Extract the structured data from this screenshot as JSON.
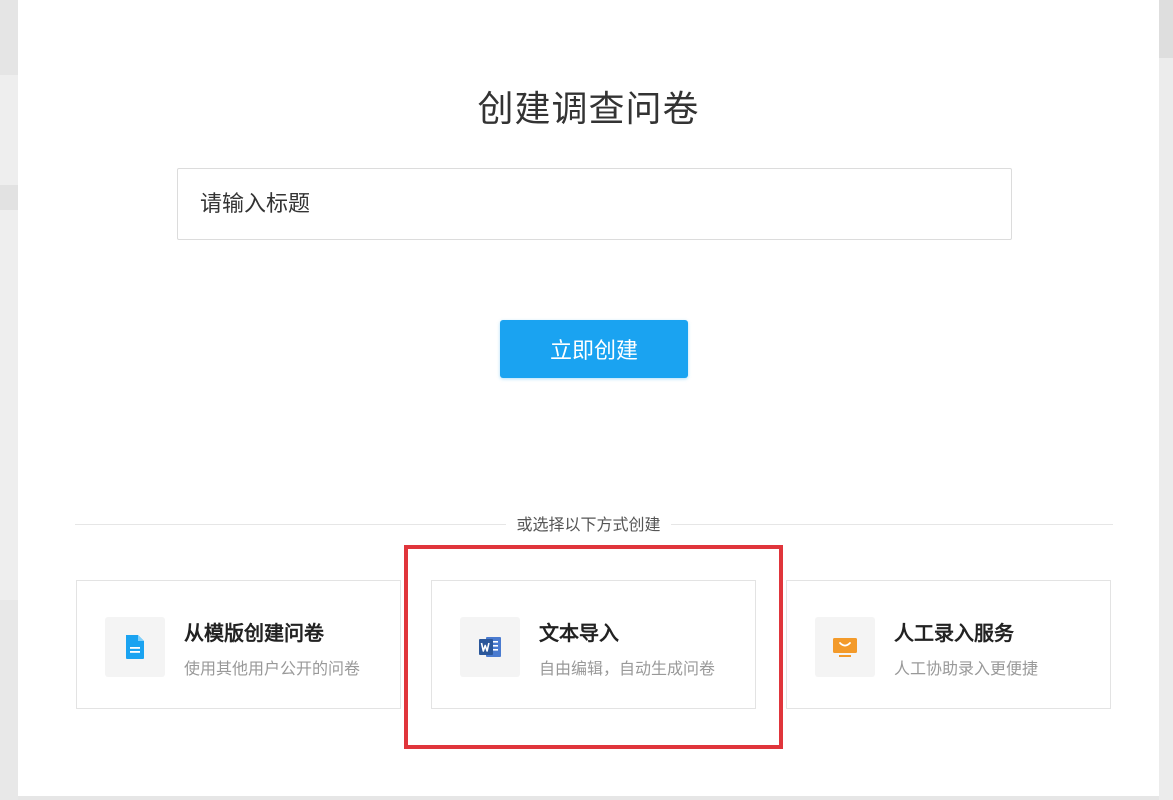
{
  "modal": {
    "title": "创建调查问卷",
    "title_input": {
      "value": "",
      "placeholder": "请输入标题"
    },
    "create_button_label": "立即创建"
  },
  "alternatives": {
    "divider_label": "或选择以下方式创建",
    "options": [
      {
        "title": "从模版创建问卷",
        "description": "使用其他用户公开的问卷",
        "icon": "document-icon",
        "icon_color": "#1aa3f1"
      },
      {
        "title": "文本导入",
        "description": "自由编辑，自动生成问卷",
        "icon": "word-icon",
        "icon_color": "#2b579a"
      },
      {
        "title": "人工录入服务",
        "description": "人工协助录入更便捷",
        "icon": "monitor-icon",
        "icon_color": "#f39a2a"
      }
    ]
  },
  "colors": {
    "primary": "#1aa3f1",
    "highlight": "#e0353b"
  }
}
